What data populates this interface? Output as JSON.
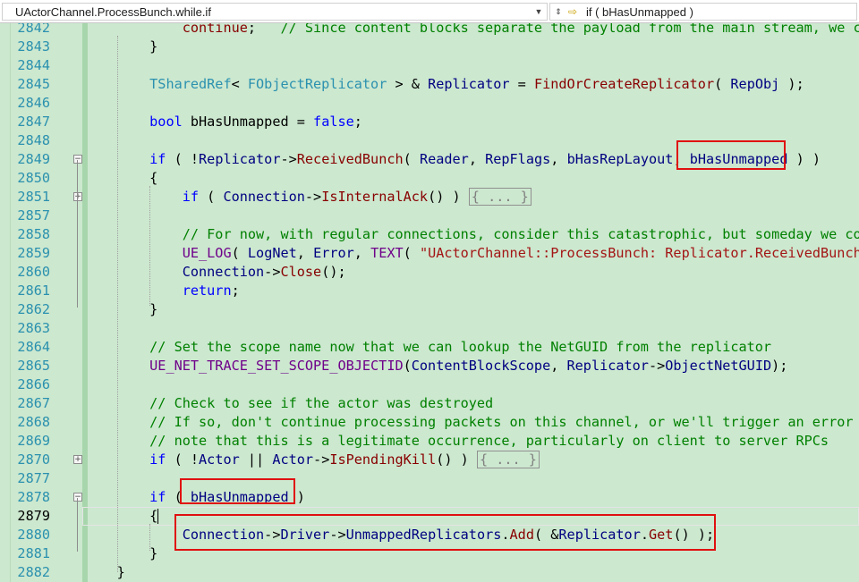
{
  "navigation_bar": {
    "scope_label": "UActorChannel.ProcessBunch.while.if",
    "member_label": "if ( bHasUnmapped )",
    "member_icon": "code-block-icon"
  },
  "editor": {
    "colors": {
      "background": "#cce8cf",
      "keyword": "#0000ff",
      "type": "#2b91af",
      "function": "#880000",
      "comment": "#008000",
      "string": "#a31515",
      "macro": "#6f008a",
      "line_number": "#2b91af",
      "highlight_box": "#e01010"
    },
    "current_line": "2879",
    "lines": [
      {
        "no": "2842",
        "fold": "",
        "tokens": [
          [
            "pl",
            "            "
          ],
          [
            "fn",
            "continue"
          ],
          [
            "pl",
            ";   "
          ],
          [
            "cm",
            "// Since content blocks separate the payload from the main stream, we can"
          ]
        ]
      },
      {
        "no": "2843",
        "fold": "",
        "tokens": [
          [
            "pl",
            "        }"
          ]
        ]
      },
      {
        "no": "2844",
        "fold": "",
        "tokens": []
      },
      {
        "no": "2845",
        "fold": "",
        "tokens": [
          [
            "pl",
            "        "
          ],
          [
            "ty",
            "TSharedRef"
          ],
          [
            "pl",
            "< "
          ],
          [
            "ty",
            "FObjectReplicator"
          ],
          [
            "pl",
            " > & "
          ],
          [
            "va",
            "Replicator"
          ],
          [
            "pl",
            " = "
          ],
          [
            "fn",
            "FindOrCreateReplicator"
          ],
          [
            "pl",
            "( "
          ],
          [
            "va",
            "RepObj"
          ],
          [
            "pl",
            " );"
          ]
        ]
      },
      {
        "no": "2846",
        "fold": "",
        "tokens": []
      },
      {
        "no": "2847",
        "fold": "",
        "tokens": [
          [
            "pl",
            "        "
          ],
          [
            "kw",
            "bool"
          ],
          [
            "pl",
            " bHasUnmapped = "
          ],
          [
            "kw",
            "false"
          ],
          [
            "pl",
            ";"
          ]
        ]
      },
      {
        "no": "2848",
        "fold": "",
        "tokens": []
      },
      {
        "no": "2849",
        "fold": "minus",
        "tokens": [
          [
            "pl",
            "        "
          ],
          [
            "kw",
            "if"
          ],
          [
            "pl",
            " ( !"
          ],
          [
            "va",
            "Replicator"
          ],
          [
            "pl",
            "->"
          ],
          [
            "fn",
            "ReceivedBunch"
          ],
          [
            "pl",
            "( "
          ],
          [
            "va",
            "Reader"
          ],
          [
            "pl",
            ", "
          ],
          [
            "va",
            "RepFlags"
          ],
          [
            "pl",
            ", "
          ],
          [
            "va",
            "bHasRepLayout"
          ],
          [
            "pl",
            ", "
          ],
          [
            "va",
            "bHasUnmapped"
          ],
          [
            "pl",
            " ) )"
          ]
        ]
      },
      {
        "no": "2850",
        "fold": "",
        "tokens": [
          [
            "pl",
            "        {"
          ]
        ]
      },
      {
        "no": "2851",
        "fold": "plus",
        "tokens": [
          [
            "pl",
            "            "
          ],
          [
            "kw",
            "if"
          ],
          [
            "pl",
            " ( "
          ],
          [
            "va",
            "Connection"
          ],
          [
            "pl",
            "->"
          ],
          [
            "fn",
            "IsInternalAck"
          ],
          [
            "pl",
            "() ) "
          ],
          [
            "collapsed",
            "{ ... }"
          ]
        ]
      },
      {
        "no": "2857",
        "fold": "",
        "tokens": []
      },
      {
        "no": "2858",
        "fold": "",
        "tokens": [
          [
            "pl",
            "            "
          ],
          [
            "cm",
            "// For now, with regular connections, consider this catastrophic, but someday we could"
          ]
        ]
      },
      {
        "no": "2859",
        "fold": "",
        "tokens": [
          [
            "pl",
            "            "
          ],
          [
            "mac",
            "UE_LOG"
          ],
          [
            "pl",
            "( "
          ],
          [
            "va",
            "LogNet"
          ],
          [
            "pl",
            ", "
          ],
          [
            "va",
            "Error"
          ],
          [
            "pl",
            ", "
          ],
          [
            "mac",
            "TEXT"
          ],
          [
            "pl",
            "( "
          ],
          [
            "str",
            "\"UActorChannel::ProcessBunch: Replicator.ReceivedBunch f"
          ]
        ]
      },
      {
        "no": "2860",
        "fold": "",
        "tokens": [
          [
            "pl",
            "            "
          ],
          [
            "va",
            "Connection"
          ],
          [
            "pl",
            "->"
          ],
          [
            "fn",
            "Close"
          ],
          [
            "pl",
            "();"
          ]
        ]
      },
      {
        "no": "2861",
        "fold": "",
        "tokens": [
          [
            "pl",
            "            "
          ],
          [
            "kw",
            "return"
          ],
          [
            "pl",
            ";"
          ]
        ]
      },
      {
        "no": "2862",
        "fold": "",
        "tokens": [
          [
            "pl",
            "        }"
          ]
        ]
      },
      {
        "no": "2863",
        "fold": "",
        "tokens": []
      },
      {
        "no": "2864",
        "fold": "",
        "tokens": [
          [
            "pl",
            "        "
          ],
          [
            "cm",
            "// Set the scope name now that we can lookup the NetGUID from the replicator"
          ]
        ]
      },
      {
        "no": "2865",
        "fold": "",
        "tokens": [
          [
            "pl",
            "        "
          ],
          [
            "mac",
            "UE_NET_TRACE_SET_SCOPE_OBJECTID"
          ],
          [
            "pl",
            "("
          ],
          [
            "va",
            "ContentBlockScope"
          ],
          [
            "pl",
            ", "
          ],
          [
            "va",
            "Replicator"
          ],
          [
            "pl",
            "->"
          ],
          [
            "va",
            "ObjectNetGUID"
          ],
          [
            "pl",
            ");"
          ]
        ]
      },
      {
        "no": "2866",
        "fold": "",
        "tokens": []
      },
      {
        "no": "2867",
        "fold": "",
        "tokens": [
          [
            "pl",
            "        "
          ],
          [
            "cm",
            "// Check to see if the actor was destroyed"
          ]
        ]
      },
      {
        "no": "2868",
        "fold": "",
        "tokens": [
          [
            "pl",
            "        "
          ],
          [
            "cm",
            "// If so, don't continue processing packets on this channel, or we'll trigger an error of"
          ]
        ]
      },
      {
        "no": "2869",
        "fold": "",
        "tokens": [
          [
            "pl",
            "        "
          ],
          [
            "cm",
            "// note that this is a legitimate occurrence, particularly on client to server RPCs"
          ]
        ]
      },
      {
        "no": "2870",
        "fold": "plus",
        "tokens": [
          [
            "pl",
            "        "
          ],
          [
            "kw",
            "if"
          ],
          [
            "pl",
            " ( !"
          ],
          [
            "va",
            "Actor"
          ],
          [
            "pl",
            " || "
          ],
          [
            "va",
            "Actor"
          ],
          [
            "pl",
            "->"
          ],
          [
            "fn",
            "IsPendingKill"
          ],
          [
            "pl",
            "() ) "
          ],
          [
            "collapsed",
            "{ ... }"
          ]
        ]
      },
      {
        "no": "2877",
        "fold": "",
        "tokens": []
      },
      {
        "no": "2878",
        "fold": "minus",
        "tokens": [
          [
            "pl",
            "        "
          ],
          [
            "kw",
            "if"
          ],
          [
            "pl",
            " ( "
          ],
          [
            "va",
            "bHasUnmapped"
          ],
          [
            "pl",
            " )"
          ]
        ]
      },
      {
        "no": "2879",
        "fold": "",
        "tokens": [
          [
            "pl",
            "        {"
          ]
        ]
      },
      {
        "no": "2880",
        "fold": "",
        "tokens": [
          [
            "pl",
            "            "
          ],
          [
            "va",
            "Connection"
          ],
          [
            "pl",
            "->"
          ],
          [
            "va",
            "Driver"
          ],
          [
            "pl",
            "->"
          ],
          [
            "va",
            "UnmappedReplicators"
          ],
          [
            "pl",
            "."
          ],
          [
            "fn",
            "Add"
          ],
          [
            "pl",
            "( &"
          ],
          [
            "va",
            "Replicator"
          ],
          [
            "pl",
            "."
          ],
          [
            "fn",
            "Get"
          ],
          [
            "pl",
            "() );"
          ]
        ]
      },
      {
        "no": "2881",
        "fold": "",
        "tokens": [
          [
            "pl",
            "        }"
          ]
        ]
      },
      {
        "no": "2882",
        "fold": "",
        "tokens": [
          [
            "pl",
            "    }"
          ]
        ]
      }
    ]
  }
}
